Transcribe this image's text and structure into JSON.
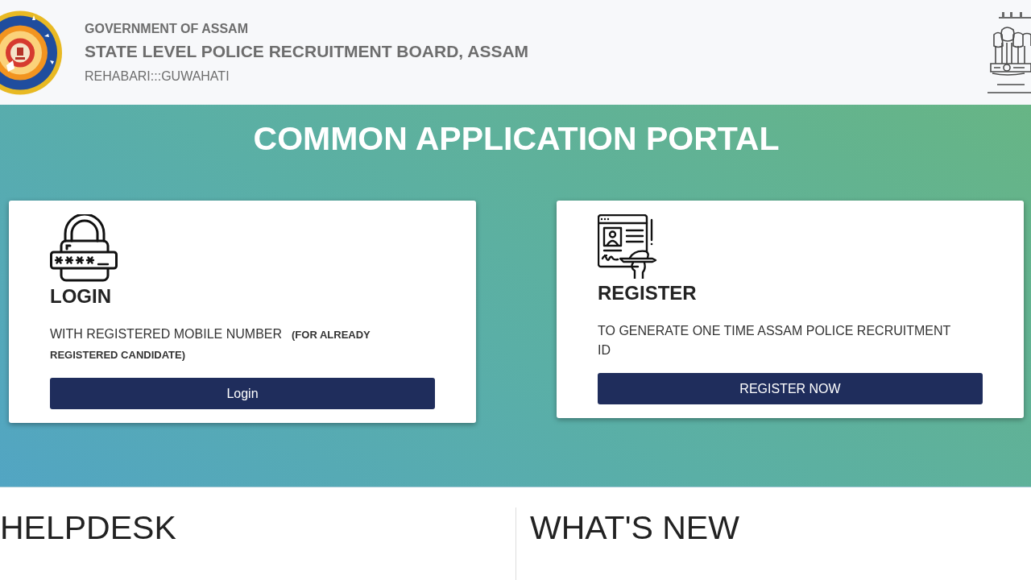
{
  "header": {
    "line_1": "GOVERNMENT OF ASSAM",
    "title": "STATE LEVEL POLICE RECRUITMENT BOARD, ASSAM",
    "location": "REHABARI:::GUWAHATI"
  },
  "hero": {
    "title": "COMMON APPLICATION PORTAL",
    "cards": [
      {
        "kind": "login",
        "heading": "LOGIN",
        "description": "WITH REGISTERED MOBILE NUMBER",
        "note": "(FOR ALREADY REGISTERED CANDIDATE)",
        "button": "Login"
      },
      {
        "kind": "register",
        "heading": "REGISTER",
        "description": "TO GENERATE ONE TIME ASSAM POLICE RECRUITMENT ID",
        "button": "REGISTER NOW"
      }
    ]
  },
  "sections": [
    {
      "title": "HELPDESK"
    },
    {
      "title": "WHAT'S NEW"
    }
  ]
}
